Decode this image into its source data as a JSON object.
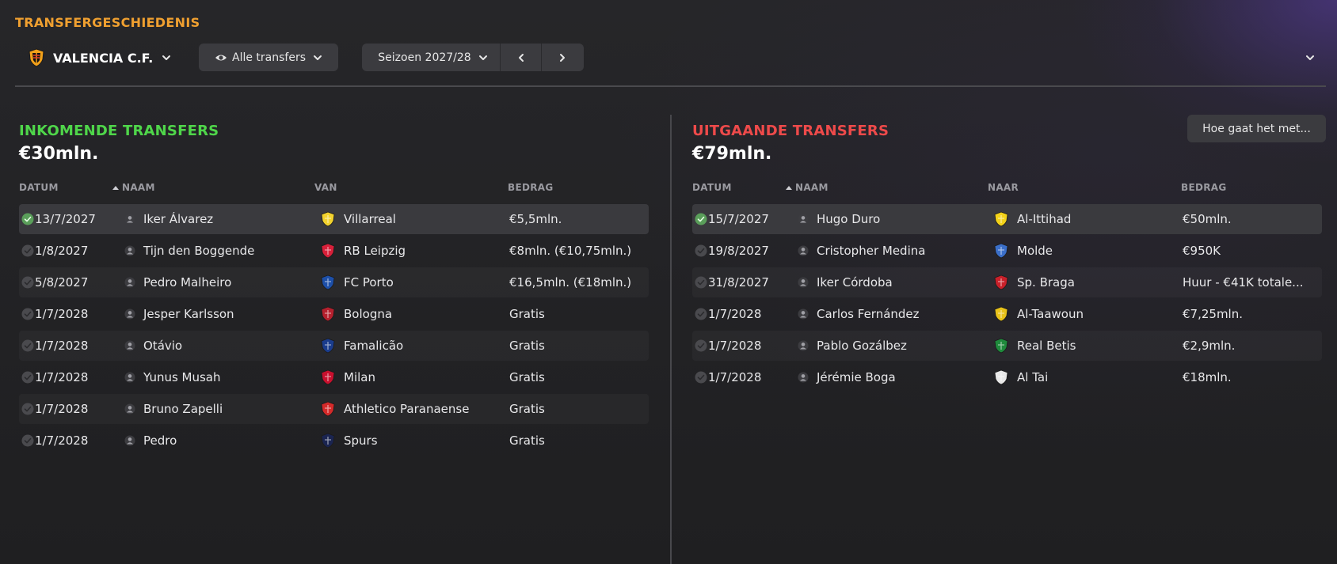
{
  "page": {
    "title": "TRANSFERGESCHIEDENIS"
  },
  "toolbar": {
    "club": "VALENCIA C.F.",
    "filter": "Alle transfers",
    "season": "Seizoen 2027/28"
  },
  "actions": {
    "hoe_gaat_het": "Hoe gaat het met..."
  },
  "incoming": {
    "title": "INKOMENDE TRANSFERS",
    "total": "€30mln.",
    "headers": {
      "date": "DATUM",
      "name": "NAAM",
      "club": "VAN",
      "fee": "BEDRAG"
    },
    "rows": [
      {
        "date": "13/7/2027",
        "name": "Iker Álvarez",
        "club": "Villarreal",
        "fee": "€5,5mln.",
        "badge": "villarreal-crest-icon",
        "color": "#f2d22e"
      },
      {
        "date": "1/8/2027",
        "name": "Tijn den Boggende",
        "club": "RB Leipzig",
        "fee": "€8mln. (€10,75mln.)",
        "badge": "rb-leipzig-crest-icon",
        "color": "#d8203a"
      },
      {
        "date": "5/8/2027",
        "name": "Pedro Malheiro",
        "club": "FC Porto",
        "fee": "€16,5mln. (€18mln.)",
        "badge": "fc-porto-crest-icon",
        "color": "#1d4fa8"
      },
      {
        "date": "1/7/2028",
        "name": "Jesper Karlsson",
        "club": "Bologna",
        "fee": "Gratis",
        "badge": "bologna-crest-icon",
        "color": "#b5202e"
      },
      {
        "date": "1/7/2028",
        "name": "Otávio",
        "club": "Famalicão",
        "fee": "Gratis",
        "badge": "famalicao-crest-icon",
        "color": "#1a3c8c"
      },
      {
        "date": "1/7/2028",
        "name": "Yunus Musah",
        "club": "Milan",
        "fee": "Gratis",
        "badge": "milan-crest-icon",
        "color": "#c8102e"
      },
      {
        "date": "1/7/2028",
        "name": "Bruno Zapelli",
        "club": "Athletico Paranaense",
        "fee": "Gratis",
        "badge": "athletico-paranaense-crest-icon",
        "color": "#d42a2a"
      },
      {
        "date": "1/7/2028",
        "name": "Pedro",
        "club": "Spurs",
        "fee": "Gratis",
        "badge": "spurs-crest-icon",
        "color": "#1a2450"
      }
    ]
  },
  "outgoing": {
    "title": "UITGAANDE TRANSFERS",
    "total": "€79mln.",
    "headers": {
      "date": "DATUM",
      "name": "NAAM",
      "club": "NAAR",
      "fee": "BEDRAG"
    },
    "rows": [
      {
        "date": "15/7/2027",
        "name": "Hugo Duro",
        "club": "Al-Ittihad",
        "fee": "€50mln.",
        "badge": "al-ittihad-crest-icon",
        "color": "#f3d21a"
      },
      {
        "date": "19/8/2027",
        "name": "Cristopher Medina",
        "club": "Molde",
        "fee": "€950K",
        "badge": "molde-crest-icon",
        "color": "#3b6fc9"
      },
      {
        "date": "31/8/2027",
        "name": "Iker Córdoba",
        "club": "Sp. Braga",
        "fee": "Huur - €41K totale...",
        "badge": "sp-braga-crest-icon",
        "color": "#c8202a"
      },
      {
        "date": "1/7/2028",
        "name": "Carlos Fernández",
        "club": "Al-Taawoun",
        "fee": "€7,25mln.",
        "badge": "al-taawoun-crest-icon",
        "color": "#e8c21a"
      },
      {
        "date": "1/7/2028",
        "name": "Pablo Gozálbez",
        "club": "Real Betis",
        "fee": "€2,9mln.",
        "badge": "real-betis-crest-icon",
        "color": "#1f8a3c"
      },
      {
        "date": "1/7/2028",
        "name": "Jérémie Boga",
        "club": "Al Tai",
        "fee": "€18mln.",
        "badge": "al-tai-crest-icon",
        "color": "#e8e8e8"
      }
    ]
  }
}
